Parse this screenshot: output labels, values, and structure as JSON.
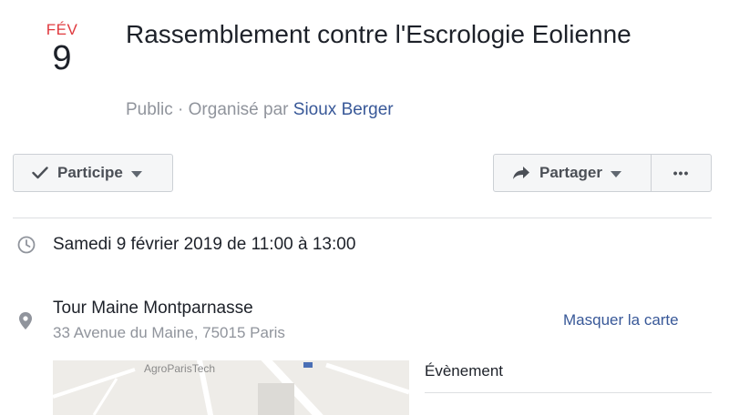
{
  "event": {
    "month": "FÉV",
    "day": "9",
    "title": "Rassemblement contre l'Escrologie Eolienne",
    "privacy": "Public",
    "separator": " · ",
    "organized_by": "Organisé par",
    "organizer": "Sioux Berger"
  },
  "actions": {
    "going_label": "Participe",
    "share_label": "Partager",
    "more_label": "•••"
  },
  "details": {
    "datetime": "Samedi 9 février 2019 de 11:00 à 13:00",
    "location_name": "Tour Maine Montparnasse",
    "location_address": "33 Avenue du Maine, 75015 Paris",
    "hide_map_label": "Masquer la carte",
    "map_label": "AgroParisTech"
  },
  "side": {
    "event_label": "Évènement"
  },
  "colors": {
    "accent_red": "#e0393e",
    "link_blue": "#385898",
    "muted": "#90949c"
  }
}
